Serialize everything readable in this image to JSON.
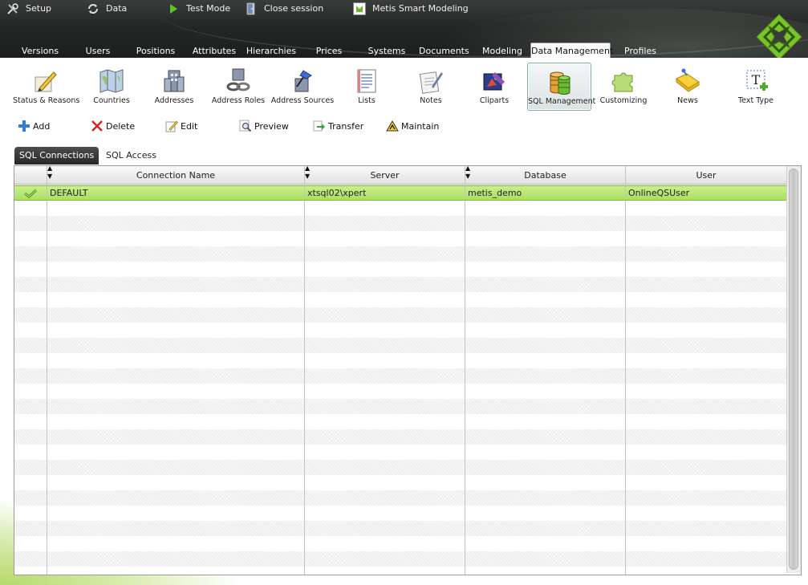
{
  "top_menu": [
    {
      "label": "Setup",
      "icon": "wrench-screwdriver-icon"
    },
    {
      "label": "Data",
      "icon": "refresh-arrows-icon"
    },
    {
      "label": "Test Mode",
      "icon": "play-icon"
    },
    {
      "label": "Close session",
      "icon": "door-exit-icon"
    },
    {
      "label": "Metis Smart Modeling",
      "icon": "app-logo-icon"
    }
  ],
  "nav_tabs": [
    {
      "label": "Versions"
    },
    {
      "label": "Users"
    },
    {
      "label": "Positions"
    },
    {
      "label": "Attributes"
    },
    {
      "label": "Hierarchies"
    },
    {
      "label": "Prices"
    },
    {
      "label": "Systems"
    },
    {
      "label": "Documents"
    },
    {
      "label": "Modeling"
    },
    {
      "label": "Data Management",
      "active": true
    },
    {
      "label": "Profiles"
    }
  ],
  "modules": [
    {
      "label": "Status & Reasons",
      "icon": "pencil-paper-icon"
    },
    {
      "label": "Countries",
      "icon": "map-icon"
    },
    {
      "label": "Addresses",
      "icon": "buildings-icon"
    },
    {
      "label": "Address Roles",
      "icon": "link-roles-icon"
    },
    {
      "label": "Address Sources",
      "icon": "push-pin-icon"
    },
    {
      "label": "Lists",
      "icon": "list-document-icon"
    },
    {
      "label": "Notes",
      "icon": "notes-icon"
    },
    {
      "label": "Cliparts",
      "icon": "cliparts-icon"
    },
    {
      "label": "SQL Management",
      "icon": "database-icon",
      "active": true
    },
    {
      "label": "Customizing",
      "icon": "puzzle-icon"
    },
    {
      "label": "News",
      "icon": "news-folder-icon"
    },
    {
      "label": "Text Type",
      "icon": "text-type-icon"
    }
  ],
  "actions": [
    {
      "label": "Add",
      "icon": "plus-icon"
    },
    {
      "label": "Delete",
      "icon": "delete-x-icon"
    },
    {
      "label": "Edit",
      "icon": "edit-pencil-icon"
    },
    {
      "label": "Preview",
      "icon": "magnifier-icon"
    },
    {
      "label": "Transfer",
      "icon": "transfer-arrow-icon"
    },
    {
      "label": "Maintain",
      "icon": "maintain-sign-icon"
    }
  ],
  "sub_tabs": [
    {
      "label": "SQL Connections",
      "active": true
    },
    {
      "label": "SQL Access"
    }
  ],
  "grid": {
    "columns": [
      "",
      "Connection Name",
      "Server",
      "Database",
      "User"
    ],
    "rows": [
      {
        "check_icon": "checkmark-icon",
        "connection_name": "DEFAULT",
        "server": "xtsql02\\xpert",
        "database": "metis_demo",
        "user": "OnlineQSUser",
        "selected": true
      }
    ],
    "empty_row_count": 25
  },
  "colors": {
    "header_dark": "#1f2220",
    "selected_row": "#b5e572",
    "accent_green": "#7cc22c"
  }
}
